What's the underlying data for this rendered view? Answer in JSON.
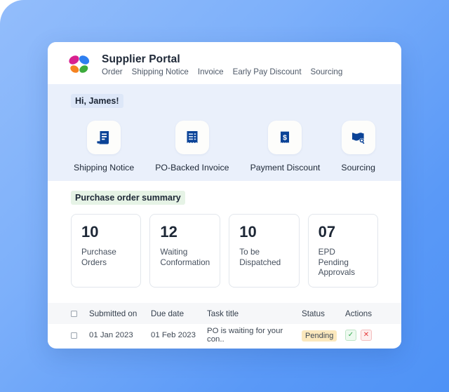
{
  "brand": {
    "title": "Supplier Portal",
    "logo_name": "butterfly-logo",
    "logo_colors": [
      "#d8208f",
      "#2f7ff0",
      "#f58220",
      "#3cab3c"
    ]
  },
  "nav": {
    "items": [
      {
        "label": "Order"
      },
      {
        "label": "Shipping Notice"
      },
      {
        "label": "Invoice"
      },
      {
        "label": "Early Pay Discount"
      },
      {
        "label": "Sourcing"
      }
    ]
  },
  "greeting": {
    "text": "Hi, James!",
    "highlight_color": "#dde7f8"
  },
  "quick_links": {
    "items": [
      {
        "label": "Shipping Notice",
        "icon": "shipping-document-icon"
      },
      {
        "label": "PO-Backed Invoice",
        "icon": "invoice-receipt-icon"
      },
      {
        "label": "Payment Discount",
        "icon": "dollar-receipt-icon"
      },
      {
        "label": "Sourcing",
        "icon": "folder-search-icon"
      }
    ],
    "icon_color": "#0b4397"
  },
  "summary": {
    "title": "Purchase order summary",
    "highlight_color": "#e6f3e6",
    "cards": [
      {
        "value": "10",
        "label": "Purchase Orders"
      },
      {
        "value": "12",
        "label": "Waiting Conformation"
      },
      {
        "value": "10",
        "label": "To be Dispatched"
      },
      {
        "value": "07",
        "label": "EPD Pending Approvals"
      }
    ]
  },
  "table": {
    "columns": {
      "select": "",
      "submitted_on": "Submitted on",
      "due_date": "Due date",
      "task_title": "Task title",
      "status": "Status",
      "actions": "Actions"
    },
    "rows": [
      {
        "submitted_on": "01 Jan 2023",
        "due_date": "01 Feb 2023",
        "task_title": "PO is waiting for your con..",
        "status": "Pending",
        "status_color": "#fbe8bd",
        "approve_icon": "check-icon",
        "reject_icon": "close-icon"
      }
    ]
  }
}
